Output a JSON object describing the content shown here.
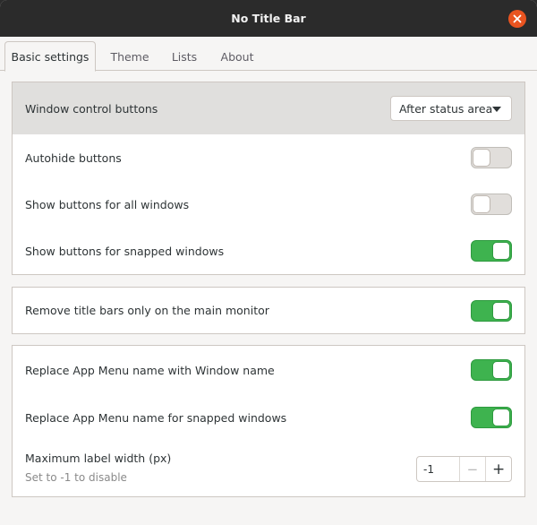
{
  "window": {
    "title": "No Title Bar",
    "close_icon": "close-icon",
    "accent": "#e95420"
  },
  "tabs": [
    {
      "label": "Basic settings",
      "active": true
    },
    {
      "label": "Theme",
      "active": false
    },
    {
      "label": "Lists",
      "active": false
    },
    {
      "label": "About",
      "active": false
    }
  ],
  "section1": {
    "window_control_buttons": {
      "label": "Window control buttons",
      "value": "After status area"
    },
    "autohide_buttons": {
      "label": "Autohide buttons",
      "state": "off"
    },
    "show_all_windows": {
      "label": "Show buttons for all windows",
      "state": "off"
    },
    "show_snapped": {
      "label": "Show buttons for snapped windows",
      "state": "on"
    }
  },
  "section2": {
    "main_monitor": {
      "label": "Remove title bars only on the main monitor",
      "state": "on"
    }
  },
  "section3": {
    "replace_window_name": {
      "label": "Replace App Menu name with Window name",
      "state": "on"
    },
    "replace_snapped": {
      "label": "Replace App Menu name for snapped windows",
      "state": "on"
    },
    "max_label_width": {
      "label": "Maximum label width (px)",
      "hint": "Set to -1 to disable",
      "value": "-1",
      "minus": "−",
      "plus": "+"
    }
  },
  "colors": {
    "toggle_on": "#3eb34f",
    "toggle_off": "#e1dedb",
    "highlight_row": "#e0dfdd"
  }
}
